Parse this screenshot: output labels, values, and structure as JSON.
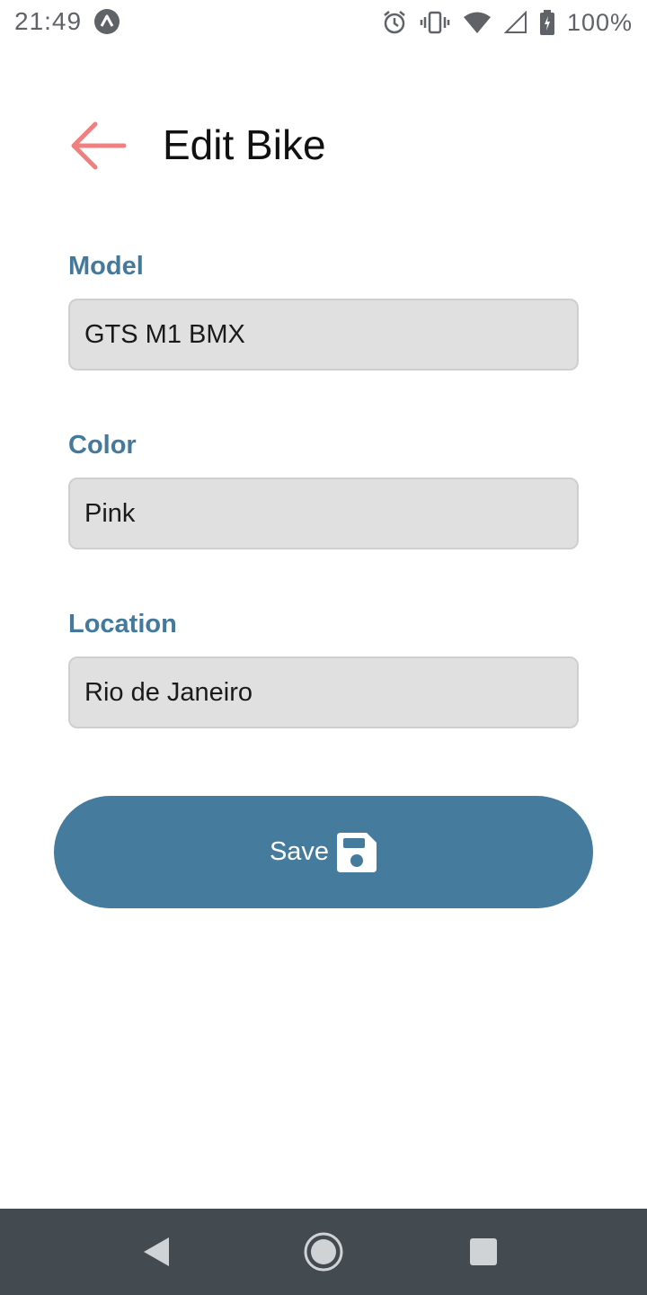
{
  "status_bar": {
    "time": "21:49",
    "battery": "100%",
    "icons": [
      "app-notification-icon",
      "alarm-icon",
      "vibrate-icon",
      "wifi-icon",
      "signal-icon",
      "battery-charging-icon"
    ]
  },
  "header": {
    "title": "Edit Bike",
    "back_icon": "arrow-left-icon",
    "back_icon_color": "#f08080"
  },
  "form": {
    "fields": [
      {
        "label": "Model",
        "value": "GTS M1 BMX"
      },
      {
        "label": "Color",
        "value": "Pink"
      },
      {
        "label": "Location",
        "value": "Rio de Janeiro"
      }
    ]
  },
  "save_button": {
    "label": "Save",
    "icon": "floppy-disk-icon"
  },
  "nav_bar": {
    "icons": [
      "nav-back-icon",
      "nav-home-icon",
      "nav-recents-icon"
    ]
  },
  "colors": {
    "accent": "#457b9d",
    "label": "#45799c",
    "input_bg": "#e0e0e0",
    "back_arrow": "#f08080",
    "nav_bar_bg": "#434a50"
  }
}
